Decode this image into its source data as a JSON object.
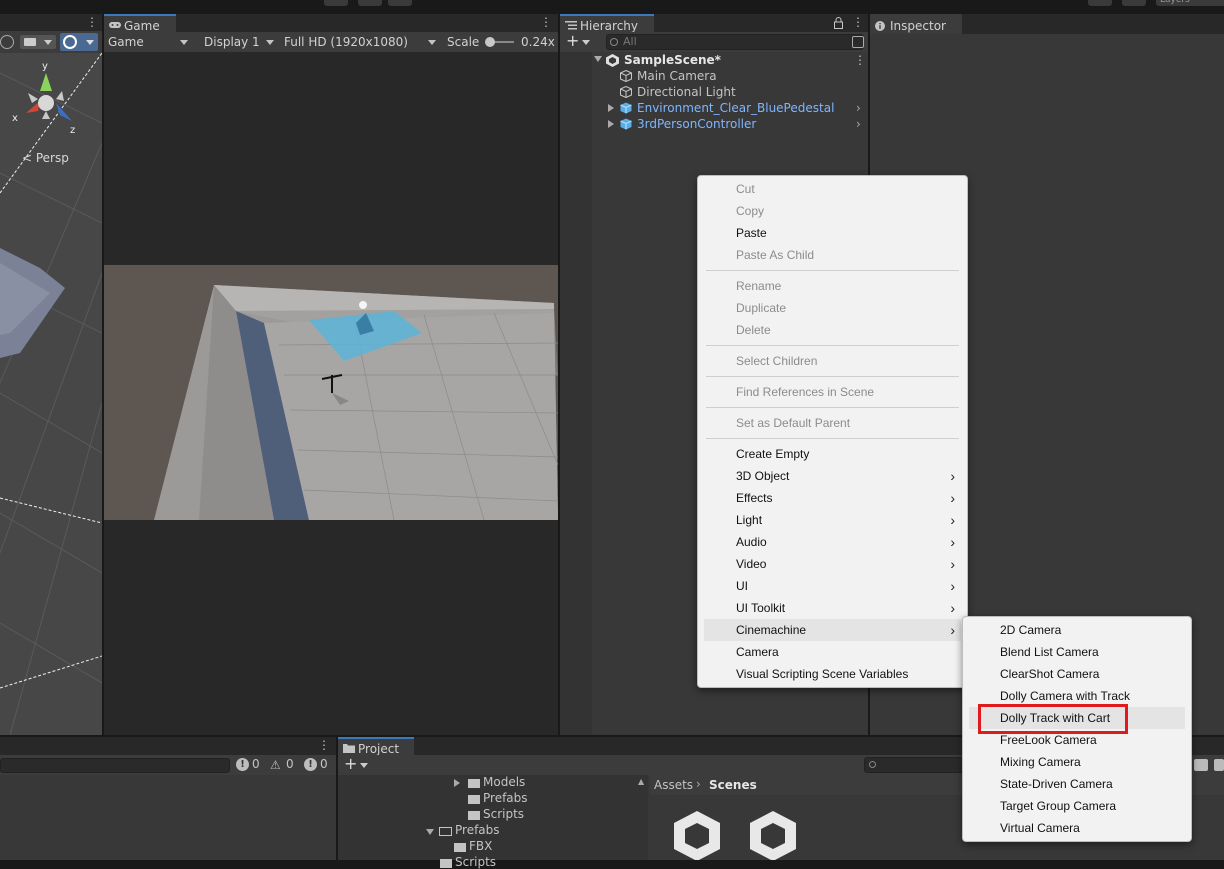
{
  "game": {
    "tab_label": "Game",
    "mode": "Game",
    "display": "Display 1",
    "resolution": "Full HD (1920x1080)",
    "scale_label": "Scale",
    "scale_value": "0.24x"
  },
  "scene": {
    "persp_label": "< Persp",
    "gizmo_y": "y",
    "gizmo_x": "x",
    "gizmo_z": "z"
  },
  "hierarchy": {
    "tab_label": "Hierarchy",
    "search_placeholder": "All",
    "scene_name": "SampleScene*",
    "items": [
      {
        "label": "Main Camera",
        "type": "object"
      },
      {
        "label": "Directional Light",
        "type": "object"
      },
      {
        "label": "Environment_Clear_BluePedestal",
        "type": "prefab"
      },
      {
        "label": "3rdPersonController",
        "type": "prefab"
      }
    ]
  },
  "inspector": {
    "tab_label": "Inspector"
  },
  "console": {
    "errors": "0",
    "warnings": "0",
    "infos": "0"
  },
  "project": {
    "tab_label": "Project",
    "tree": [
      "Models",
      "Prefabs",
      "Scripts",
      "Prefabs",
      "FBX",
      "Scripts"
    ],
    "breadcrumb_root": "Assets",
    "breadcrumb_current": "Scenes"
  },
  "toolbar": {
    "layers_label": "Layers"
  },
  "context_menu": {
    "items": [
      {
        "label": "Cut",
        "disabled": true
      },
      {
        "label": "Copy",
        "disabled": true
      },
      {
        "label": "Paste",
        "disabled": false
      },
      {
        "label": "Paste As Child",
        "disabled": true
      },
      {
        "label": "Rename",
        "disabled": true
      },
      {
        "label": "Duplicate",
        "disabled": true
      },
      {
        "label": "Delete",
        "disabled": true
      },
      {
        "label": "Select Children",
        "disabled": true
      },
      {
        "label": "Find References in Scene",
        "disabled": true
      },
      {
        "label": "Set as Default Parent",
        "disabled": true
      },
      {
        "label": "Create Empty",
        "disabled": false
      },
      {
        "label": "3D Object",
        "disabled": false,
        "submenu": true
      },
      {
        "label": "Effects",
        "disabled": false,
        "submenu": true
      },
      {
        "label": "Light",
        "disabled": false,
        "submenu": true
      },
      {
        "label": "Audio",
        "disabled": false,
        "submenu": true
      },
      {
        "label": "Video",
        "disabled": false,
        "submenu": true
      },
      {
        "label": "UI",
        "disabled": false,
        "submenu": true
      },
      {
        "label": "UI Toolkit",
        "disabled": false,
        "submenu": true
      },
      {
        "label": "Cinemachine",
        "disabled": false,
        "submenu": true,
        "highlighted": true
      },
      {
        "label": "Camera",
        "disabled": false
      },
      {
        "label": "Visual Scripting Scene Variables",
        "disabled": false
      }
    ]
  },
  "cinemachine_menu": {
    "items": [
      {
        "label": "2D Camera"
      },
      {
        "label": "Blend List Camera"
      },
      {
        "label": "ClearShot Camera"
      },
      {
        "label": "Dolly Camera with Track"
      },
      {
        "label": "Dolly Track with Cart",
        "highlighted": true
      },
      {
        "label": "FreeLook Camera"
      },
      {
        "label": "Mixing Camera"
      },
      {
        "label": "State-Driven Camera"
      },
      {
        "label": "Target Group Camera"
      },
      {
        "label": "Virtual Camera"
      }
    ]
  },
  "colors": {
    "accent": "#3a79bb",
    "highlight_box": "#e01b1b",
    "prefab_blue": "#7eb6ff"
  }
}
